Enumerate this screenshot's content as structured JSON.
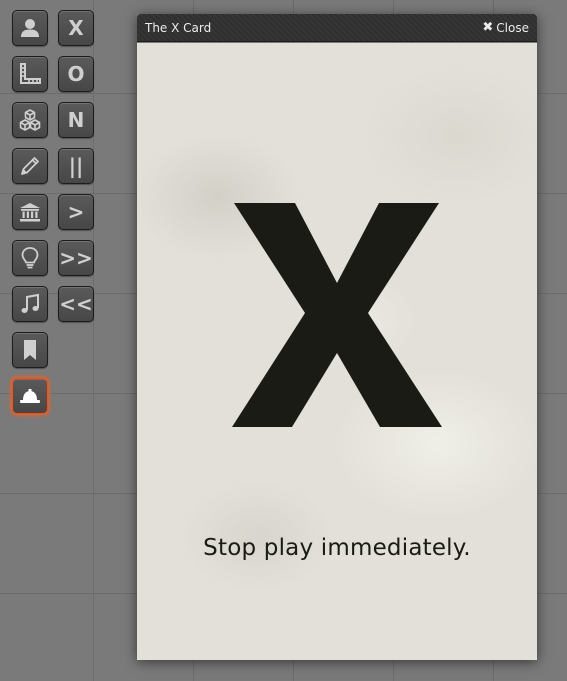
{
  "toolbar": {
    "tools": [
      {
        "name": "character-tool",
        "icon": "person-icon",
        "active": false
      },
      {
        "name": "measure-tool",
        "icon": "ruler-icon",
        "active": false
      },
      {
        "name": "components-tool",
        "icon": "cubes-icon",
        "active": false
      },
      {
        "name": "drawing-tool",
        "icon": "pencil-icon",
        "active": false
      },
      {
        "name": "tables-tool",
        "icon": "bank-icon",
        "active": false
      },
      {
        "name": "lighting-tool",
        "icon": "lightbulb-icon",
        "active": false
      },
      {
        "name": "music-tool",
        "icon": "music-note-icon",
        "active": false
      },
      {
        "name": "notes-tool",
        "icon": "bookmark-icon",
        "active": false
      },
      {
        "name": "safety-tool",
        "icon": "hard-hat-icon",
        "active": true
      }
    ],
    "macros": [
      "X",
      "O",
      "N",
      "||",
      ">",
      ">>",
      "<<"
    ]
  },
  "dialog": {
    "title": "The X Card",
    "close_label": "Close",
    "card_symbol": "X",
    "caption": "Stop play immediately."
  },
  "colors": {
    "background": "#7a7a7a",
    "button_bg": "#4f4f4f",
    "active_glow": "#ff5d1a",
    "card_bg": "#e2e0d8",
    "card_ink": "#1b1b16",
    "header_bg": "#2f2f2f"
  }
}
